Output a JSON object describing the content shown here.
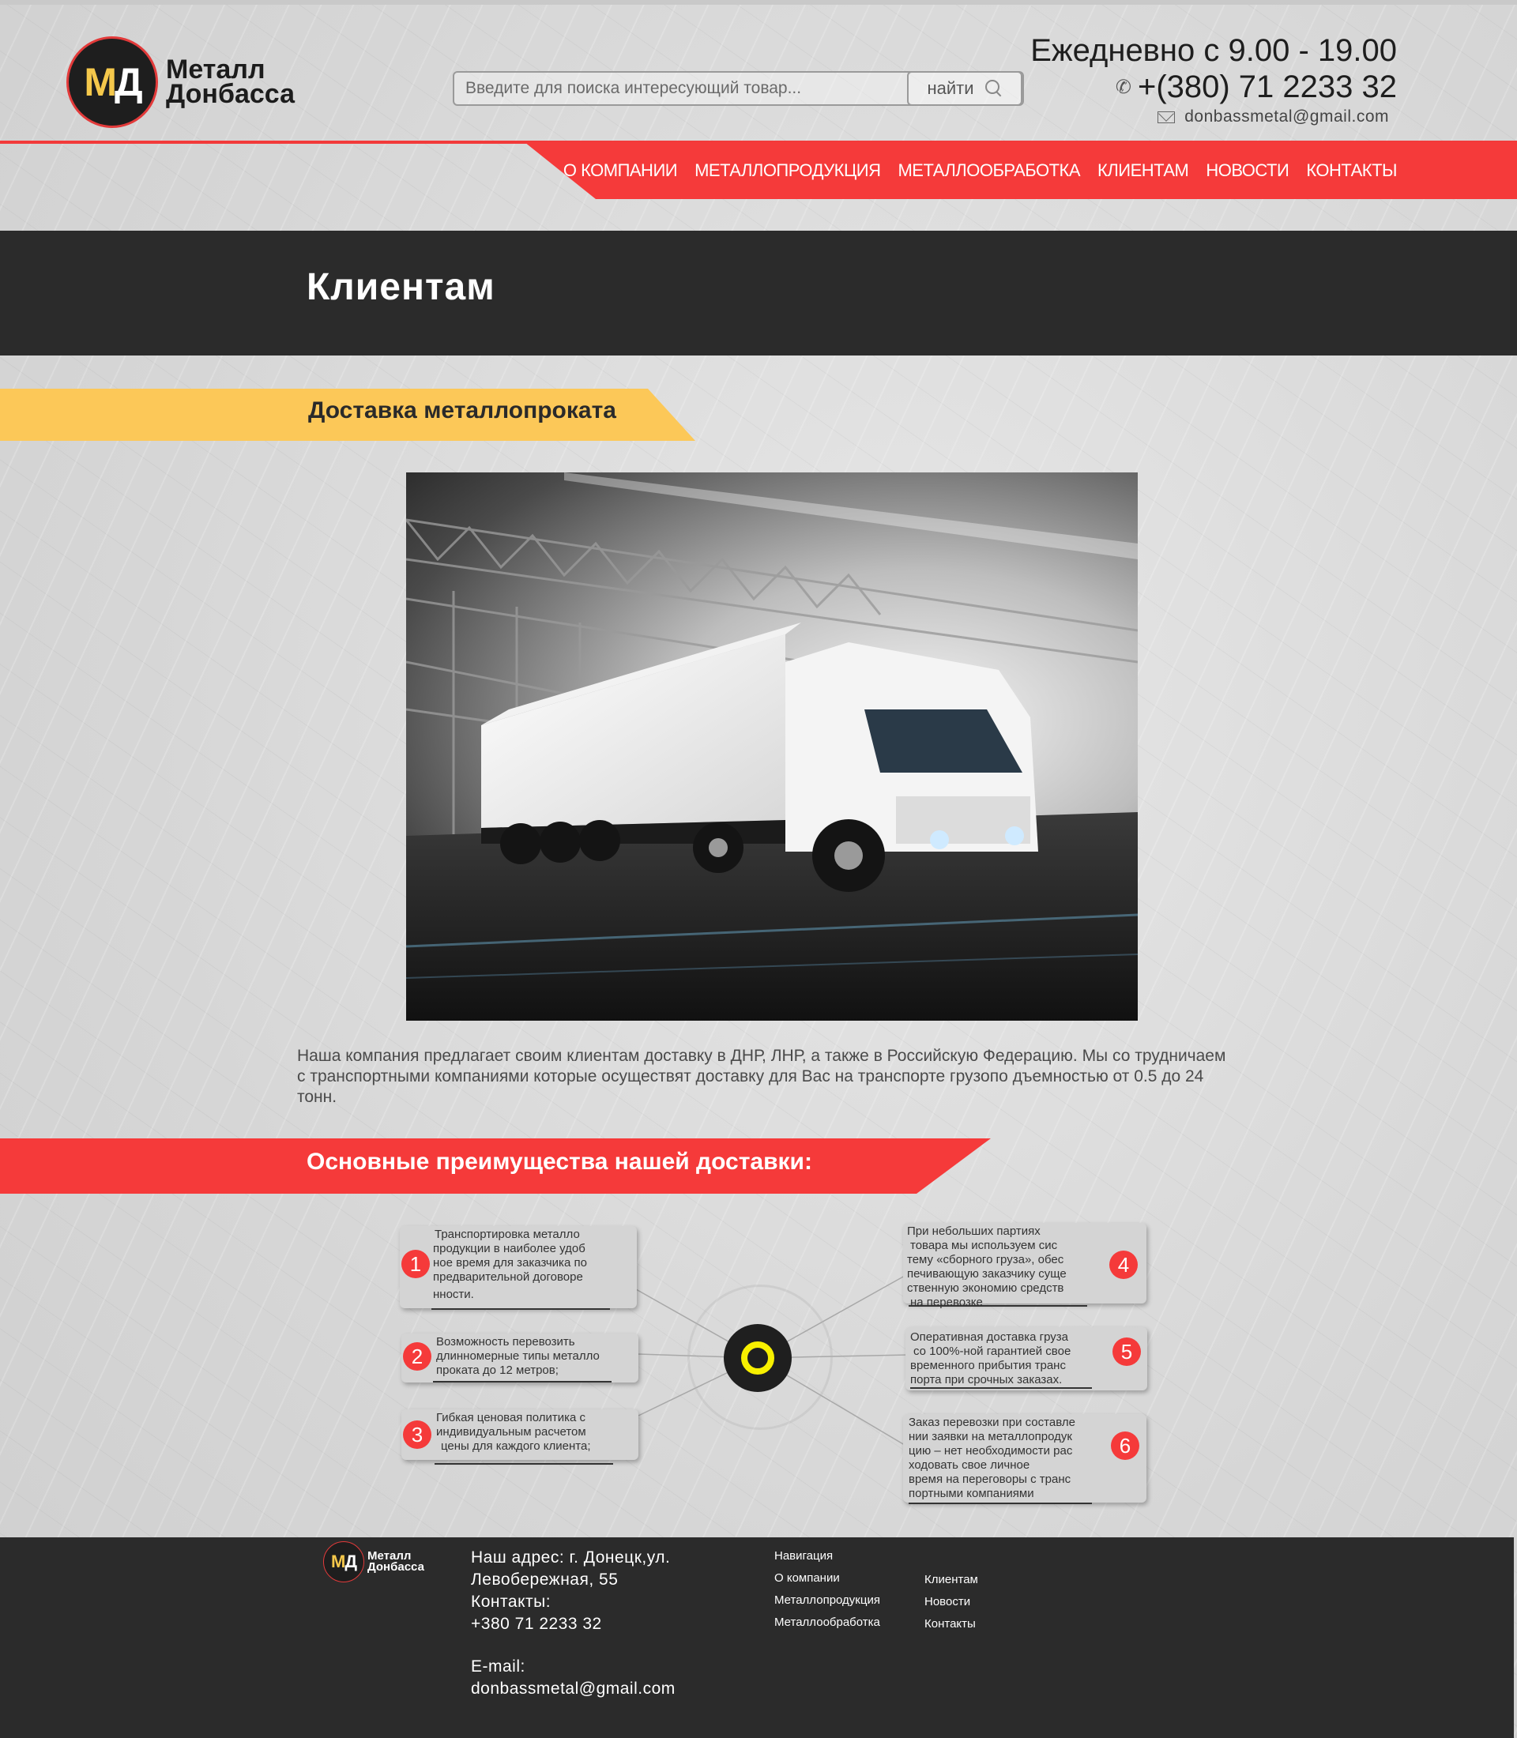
{
  "header": {
    "logo_mark_m": "М",
    "logo_mark_d": "Д",
    "logo_line1": "Металл",
    "logo_line2": "Донбасса",
    "search_placeholder": "Введите для поиска интересующий товар...",
    "search_button": "найти",
    "hours": "Ежедневно с 9.00 - 19.00",
    "phone": "+(380) 71 2233 32",
    "email": "donbassmetal@gmail.com"
  },
  "nav": {
    "items": [
      "О КОМПАНИИ",
      "МЕТАЛЛОПРОДУКЦИЯ",
      "МЕТАЛЛООБРАБОТКА",
      "КЛИЕНТАМ",
      "НОВОСТИ",
      "КОНТАКТЫ"
    ]
  },
  "page": {
    "title": "Клиентам",
    "section1_title": "Доставка металлопроката",
    "description": "Наша компания предлагает своим клиентам доставку в ДНР, ЛНР, а также в Российскую Федерацию. Мы со трудничаем с транспортными компаниями которые осуществят доставку для Вас на транспорте грузопо дъемностью от 0.5 до 24 тонн.",
    "section2_title": "Основные преимущества нашей доставки:"
  },
  "advantages": [
    {
      "num": "1",
      "lines": [
        "Транспортировка металло",
        "продукции в наиболее удоб",
        "ное время для заказчика по",
        "предварительной договоре",
        "нности."
      ]
    },
    {
      "num": "2",
      "lines": [
        "Возможность перевозить",
        "длинномерные типы металло",
        "проката до 12 метров;"
      ]
    },
    {
      "num": "3",
      "lines": [
        "Гибкая ценовая политика с",
        "индивидуальным расчетом",
        "цены для каждого клиента;"
      ]
    },
    {
      "num": "4",
      "lines": [
        "При небольших партиях",
        "товара мы используем сис",
        "тему «сборного груза», обес",
        "печивающую заказчику суще",
        "ственную экономию средств",
        "на перевозке"
      ]
    },
    {
      "num": "5",
      "lines": [
        "Оперативная доставка груза",
        "со 100%-ной гарантией свое",
        "временного прибытия транс",
        "порта при срочных заказах."
      ]
    },
    {
      "num": "6",
      "lines": [
        "Заказ перевозки при составле",
        "нии заявки на металлопродук",
        "цию – нет необходимости рас",
        "ходовать свое личное",
        "время на переговоры с транс",
        "портными компаниями"
      ]
    }
  ],
  "footer": {
    "logo_mark_m": "М",
    "logo_mark_d": "Д",
    "logo_line1": "Металл",
    "logo_line2": "Донбасса",
    "address_line1": "Наш адрес: г. Донецк,ул.",
    "address_line2": "Левобережная, 55",
    "contacts_label": "Контакты:",
    "phone": "+380 71 2233 32",
    "email_label": "E-mail:",
    "email": "donbassmetal@gmail.com",
    "nav_col1": [
      "Навигация",
      "О компании",
      "Металлопродукция",
      "Металлообработка"
    ],
    "nav_col2": [
      "Клиентам",
      "Новости",
      "Контакты"
    ]
  },
  "colors": {
    "accent_red": "#f53a3a",
    "accent_yellow": "#fcc858",
    "dark": "#2b2b2b"
  }
}
